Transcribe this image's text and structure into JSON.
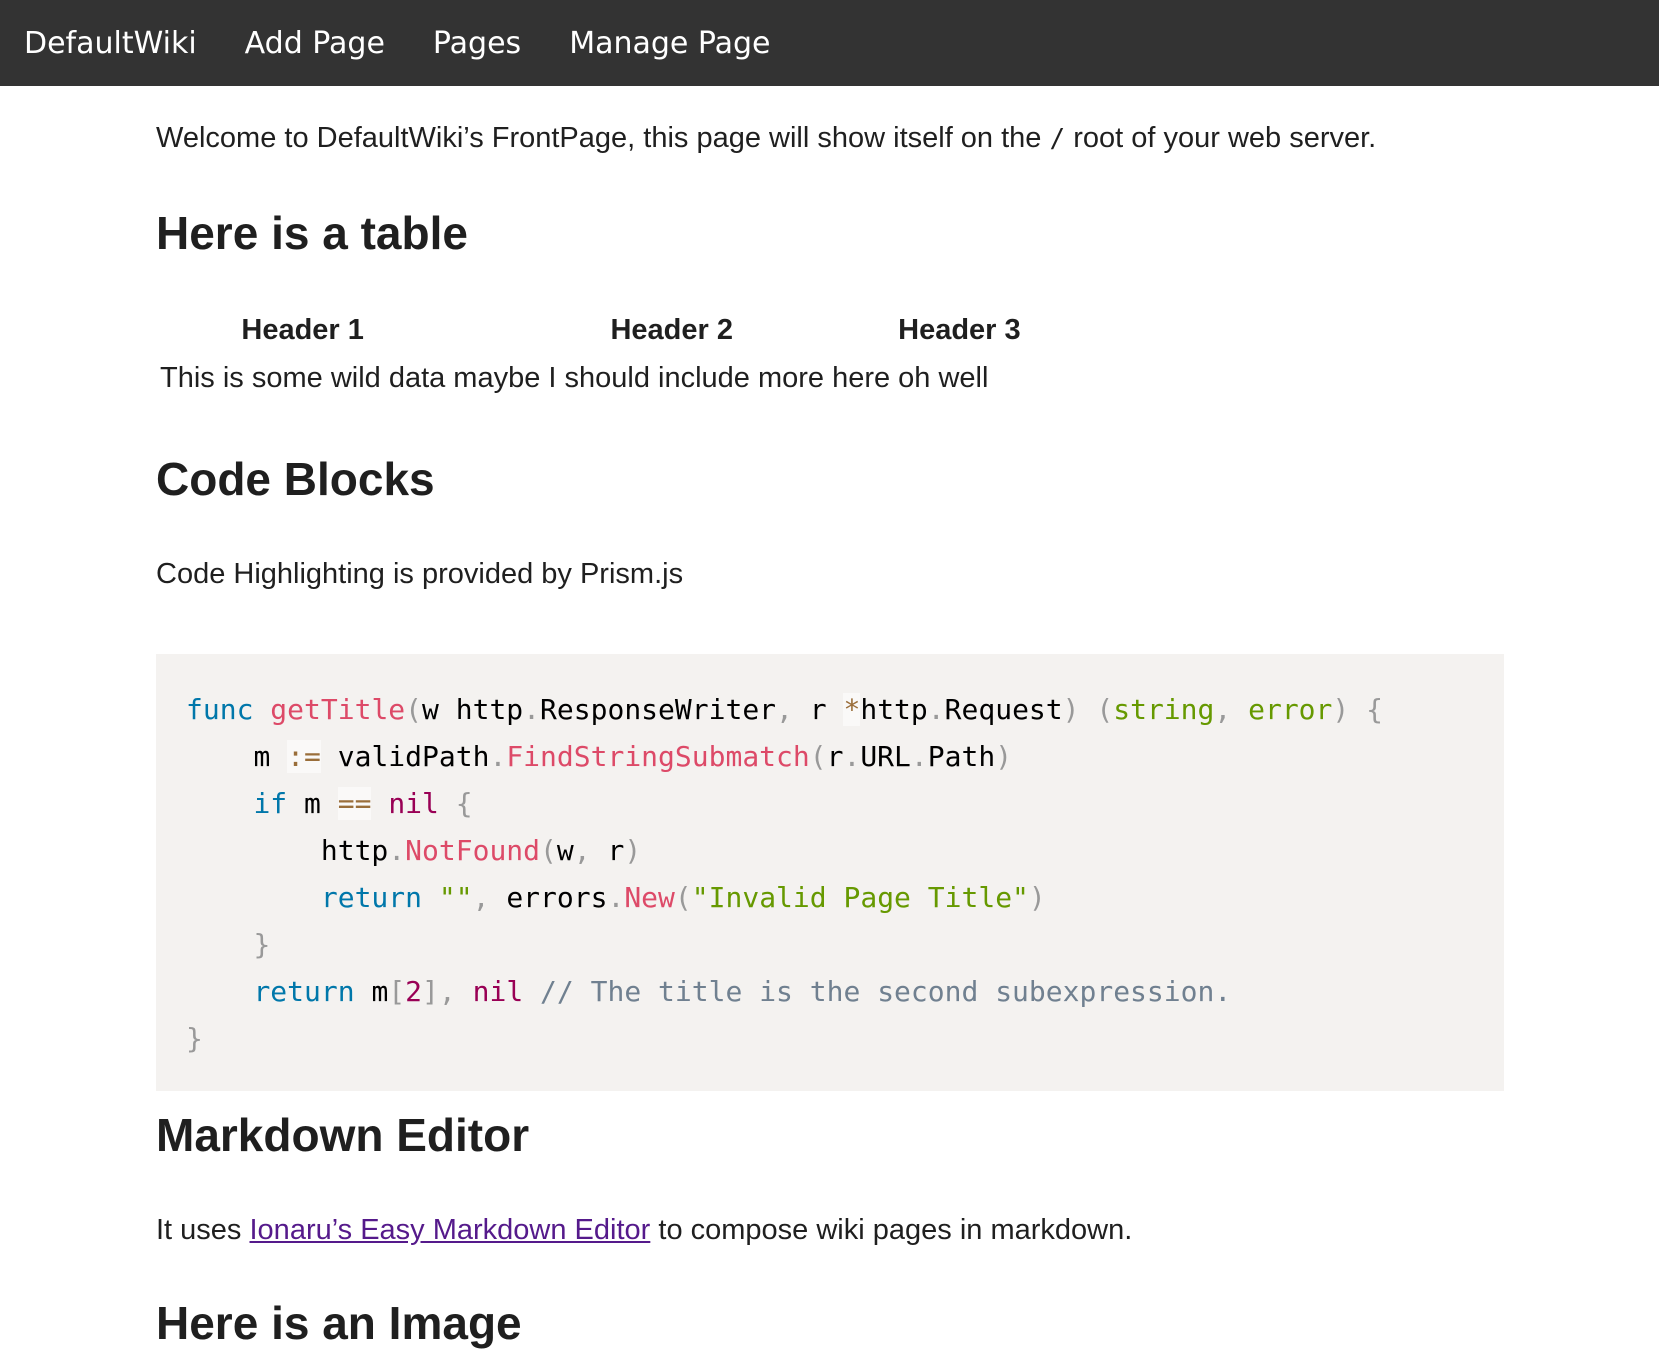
{
  "nav": {
    "brand": "DefaultWiki",
    "items": [
      {
        "label": "Add Page"
      },
      {
        "label": "Pages"
      },
      {
        "label": "Manage Page"
      }
    ]
  },
  "intro": {
    "before": "Welcome to DefaultWiki’s FrontPage, this page will show itself on the ",
    "code": "/",
    "after": " root of your web server."
  },
  "sections": {
    "table_heading": "Here is a table",
    "code_heading": "Code Blocks",
    "markdown_heading": "Markdown Editor",
    "image_heading": "Here is an Image"
  },
  "table": {
    "headers": [
      "Header 1",
      "Header 2",
      "Header 3"
    ],
    "rows": [
      [
        "This is some wild data",
        "maybe I should include more here",
        "oh well"
      ]
    ]
  },
  "code_desc": "Code Highlighting is provided by Prism.js",
  "markdown": {
    "before": "It uses ",
    "link_text": "Ionaru’s Easy Markdown Editor",
    "after": " to compose wiki pages in markdown."
  },
  "code": {
    "tokens": {
      "func": "func",
      "getTitle": "getTitle",
      "w": "w",
      "http": "http",
      "ResponseWriter": "ResponseWriter",
      "r": "r",
      "star": "*",
      "Request": "Request",
      "string": "string",
      "error": "error",
      "m": "m",
      "assign": ":=",
      "validPath": "validPath",
      "FindStringSubmatch": "FindStringSubmatch",
      "URL": "URL",
      "Path": "Path",
      "if": "if",
      "eq": "==",
      "nil": "nil",
      "NotFound": "NotFound",
      "return": "return",
      "empty_str": "\"\"",
      "errors": "errors",
      "New": "New",
      "invalid_str": "\"Invalid Page Title\"",
      "two": "2",
      "comment": "// The title is the second subexpression."
    }
  }
}
